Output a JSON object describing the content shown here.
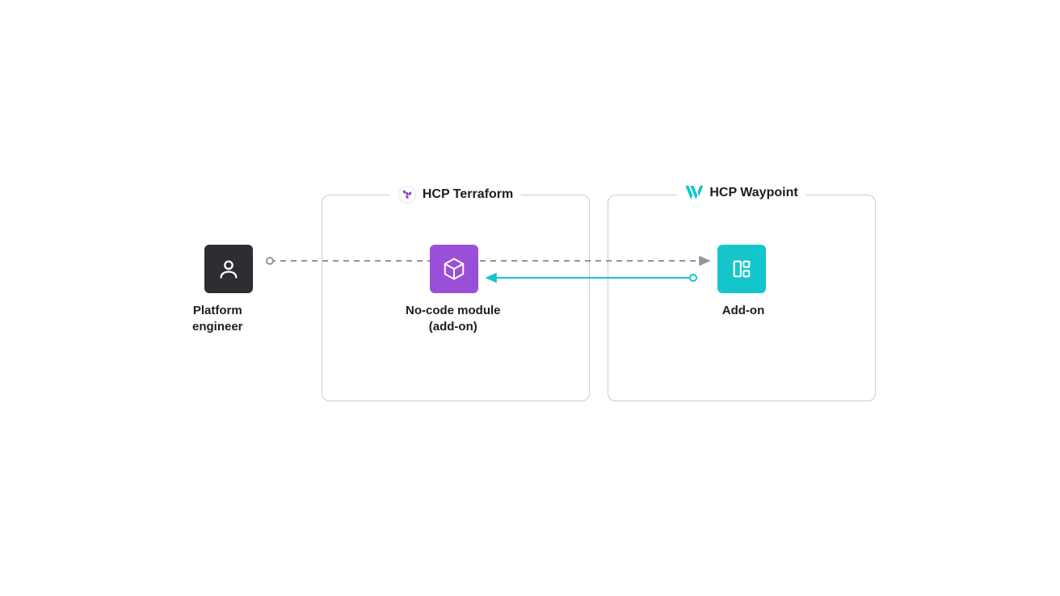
{
  "nodes": {
    "engineer": {
      "label_line1": "Platform",
      "label_line2": "engineer"
    },
    "nocode": {
      "label_line1": "No-code module",
      "label_line2": "(add-on)"
    },
    "addon": {
      "label": "Add-on"
    }
  },
  "panels": {
    "terraform": {
      "title": "HCP Terraform"
    },
    "waypoint": {
      "title": "HCP Waypoint"
    }
  },
  "colors": {
    "dark": "#2c2e33",
    "purple": "#9a4fd9",
    "teal": "#14c6cb",
    "gray": "#8f97a3"
  }
}
